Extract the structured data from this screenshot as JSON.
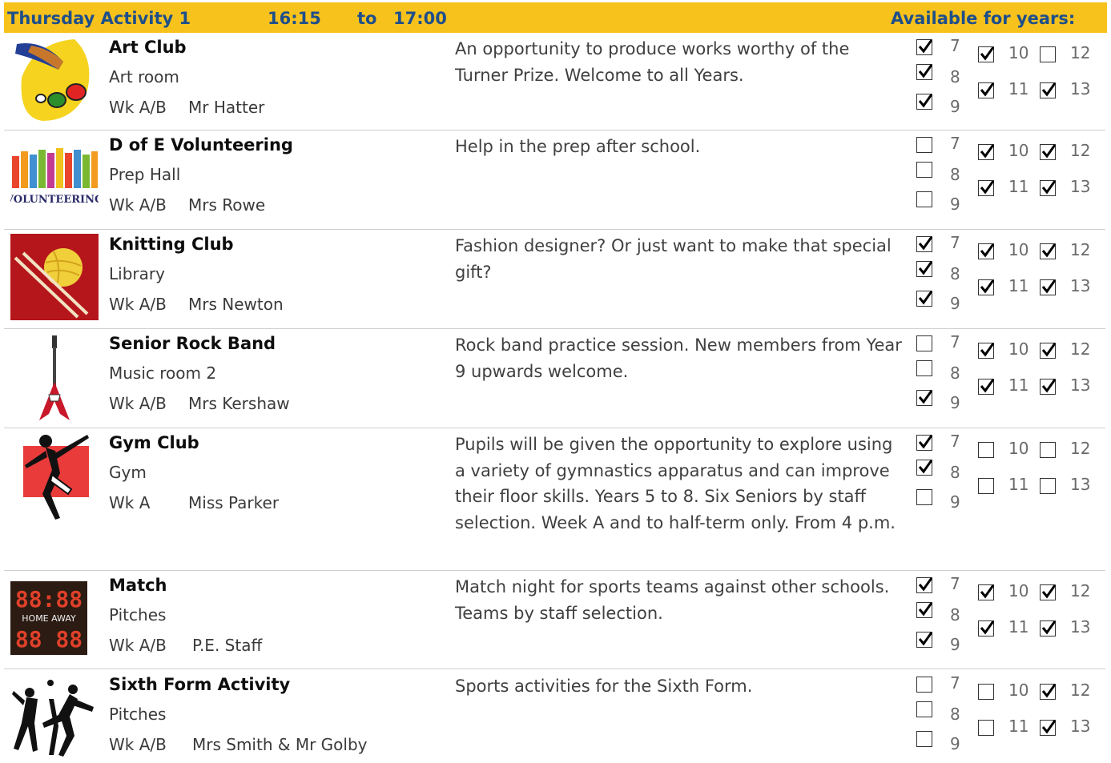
{
  "header": {
    "activity": "Thursday Activity 1",
    "start_time": "16:15",
    "to": "to",
    "end_time": "17:00",
    "available": "Available for years:"
  },
  "activities": [
    {
      "title": "Art Club",
      "room": "Art room",
      "week": "Wk  A/B",
      "teacher": "Mr Hatter",
      "description": "An opportunity to produce works worthy of the Turner Prize.  Welcome to all Years.",
      "image": "palette-icon",
      "years": {
        "7": true,
        "8": true,
        "9": true,
        "10": true,
        "11": true,
        "12": false,
        "13": true
      }
    },
    {
      "title": "D of E Volunteering",
      "room": "Prep Hall",
      "week": "Wk  A/B",
      "teacher": "Mrs Rowe",
      "description": "Help in the prep after school.",
      "image": "volunteering-hands-icon",
      "image_text": "VOLUNTEERING",
      "years": {
        "7": false,
        "8": false,
        "9": false,
        "10": true,
        "11": true,
        "12": true,
        "13": true
      }
    },
    {
      "title": "Knitting Club",
      "room": "Library",
      "week": "Wk  A/B",
      "teacher": "Mrs Newton",
      "description": "Fashion designer? Or just want to make that special gift?",
      "image": "yarn-ball-icon",
      "years": {
        "7": true,
        "8": true,
        "9": true,
        "10": true,
        "11": true,
        "12": true,
        "13": true
      }
    },
    {
      "title": "Senior Rock Band",
      "room": "Music room 2",
      "week": "Wk  A/B",
      "teacher": "Mrs Kershaw",
      "description": "Rock band practice session.  New members from Year 9 upwards welcome.",
      "image": "electric-guitar-icon",
      "years": {
        "7": false,
        "8": false,
        "9": true,
        "10": true,
        "11": true,
        "12": true,
        "13": true
      }
    },
    {
      "title": "Gym Club",
      "room": "Gym",
      "week": "Wk     A",
      "teacher": "Miss Parker",
      "description": "Pupils will be given the opportunity to explore using a variety of gymnastics apparatus and can improve their floor skills.  Years 5 to 8.   Six Seniors by staff selection.  Week A and to half-term only.  From 4 p.m.",
      "image": "gymnast-icon",
      "years": {
        "7": true,
        "8": true,
        "9": false,
        "10": false,
        "11": false,
        "12": false,
        "13": false
      }
    },
    {
      "title": "Match",
      "room": "Pitches",
      "week": "Wk  A/B",
      "teacher": "P.E. Staff",
      "description": "Match night for sports teams against other schools.  Teams by staff selection.",
      "image": "scoreboard-icon",
      "image_text": {
        "digits_top": "88:88",
        "labels": "HOME AWAY",
        "digits_bottom": "88 88"
      },
      "years": {
        "7": true,
        "8": true,
        "9": true,
        "10": true,
        "11": true,
        "12": true,
        "13": true
      }
    },
    {
      "title": "Sixth Form Activity",
      "room": "Pitches",
      "week": "Wk  A/B",
      "teacher": "Mrs Smith & Mr Golby",
      "description": "Sports activities for the Sixth Form.",
      "image": "sports-silhouettes-icon",
      "years": {
        "7": false,
        "8": false,
        "9": false,
        "10": false,
        "11": false,
        "12": true,
        "13": true
      }
    }
  ]
}
